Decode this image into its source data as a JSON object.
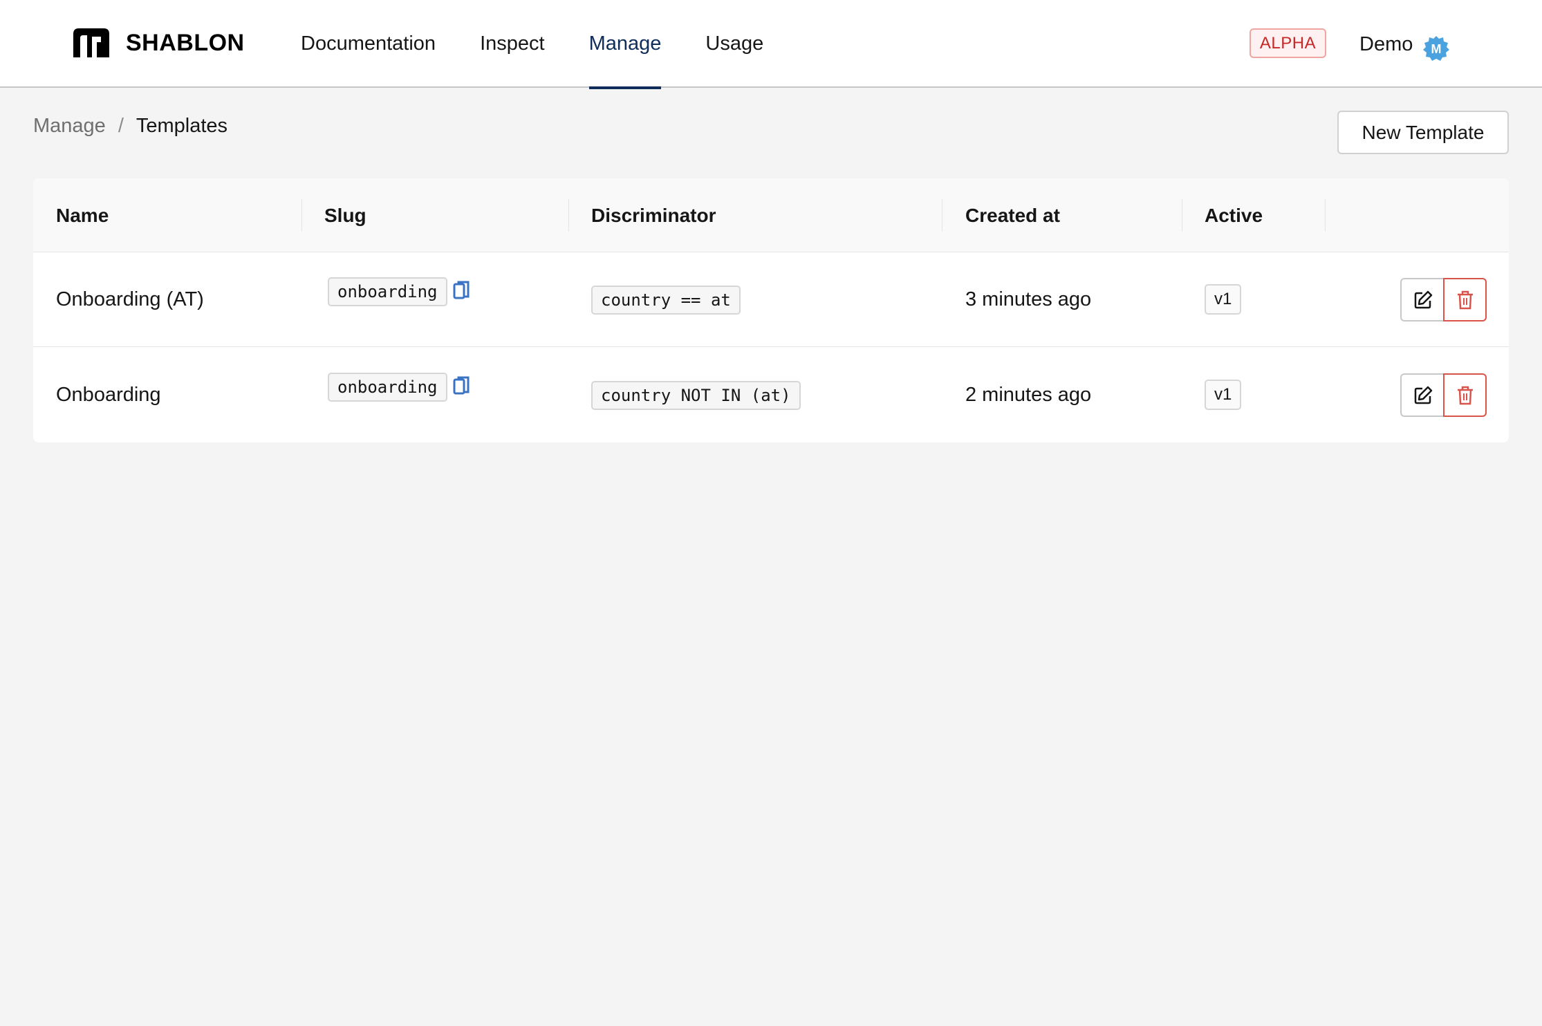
{
  "header": {
    "brand": "SHABLON",
    "nav": [
      {
        "label": "Documentation",
        "active": false
      },
      {
        "label": "Inspect",
        "active": false
      },
      {
        "label": "Manage",
        "active": true
      },
      {
        "label": "Usage",
        "active": false
      }
    ],
    "badge": "ALPHA",
    "user": "Demo",
    "avatar_initial": "M"
  },
  "breadcrumb": {
    "parent": "Manage",
    "separator": "/",
    "current": "Templates"
  },
  "actions": {
    "new_template": "New Template"
  },
  "table": {
    "columns": [
      "Name",
      "Slug",
      "Discriminator",
      "Created at",
      "Active"
    ],
    "rows": [
      {
        "name": "Onboarding (AT)",
        "slug": "onboarding",
        "discriminator": "country == at",
        "created": "3 minutes ago",
        "active": "v1"
      },
      {
        "name": "Onboarding",
        "slug": "onboarding",
        "discriminator": "country NOT IN (at)",
        "created": "2 minutes ago",
        "active": "v1"
      }
    ]
  },
  "colors": {
    "accent": "#0f2d5c",
    "danger": "#d9534a",
    "copy_icon": "#3b73c4",
    "avatar": "#4aa3df"
  },
  "icons": {
    "copy": "copy-icon",
    "edit": "edit-icon",
    "delete": "trash-icon"
  }
}
